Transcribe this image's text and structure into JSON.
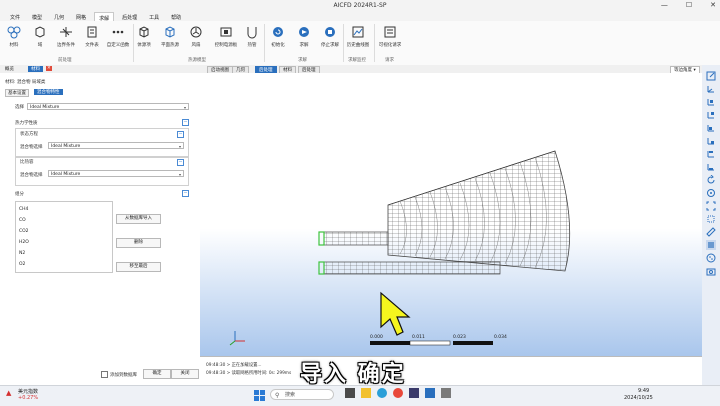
{
  "window": {
    "title": "AICFD 2024R1-SP",
    "controls": [
      "—",
      "☐",
      "✕"
    ]
  },
  "menu": [
    "文件",
    "模型",
    "几何",
    "网格",
    "求解",
    "后处理",
    "工具",
    "帮助"
  ],
  "menu_active_index": 4,
  "ribbon": {
    "buttons": [
      "材料",
      "域",
      "边界条件",
      "文件表",
      "自定义函数",
      "体源项",
      "平面热源",
      "风扇",
      "控制电源板",
      "热管",
      "初始化",
      "求解",
      "停止求解",
      "历史曲线图",
      "可视化请求"
    ],
    "groups": [
      "前处理",
      "热源模型",
      "求解",
      "求解监控",
      "请求"
    ]
  },
  "left_tabs": [
    "概览",
    "材料"
  ],
  "panel": {
    "breadcrumb": "材料: 混合物 局域类",
    "subtabs": [
      "基本设置",
      "混合物特性"
    ],
    "select_label": "选择",
    "select_value": "Ideal Mixture",
    "thermo_section": "热力学性质",
    "eos_label": "状态方程",
    "mix_select_label": "混合物选择",
    "eos_value": "Ideal Mixture",
    "cp_label": "比热容",
    "cp_value": "Ideal Mixture",
    "components_section": "组分",
    "components": [
      "CH4",
      "CO",
      "CO2",
      "H2O",
      "N2",
      "O2"
    ],
    "import_button": "从数据库导入",
    "delete_button": "删除",
    "move_last_button": "移至最后",
    "add_db_checkbox": "添加到数据库",
    "ok_button": "确定",
    "close_button": "关闭"
  },
  "viewport": {
    "tabs": [
      "启动视图",
      "几何",
      "后处理",
      "材料",
      "后处理"
    ],
    "active_tab_index": 2,
    "view_select": "等边角度",
    "scale_labels": [
      "0.000",
      "0.011",
      "0.023",
      "0.034"
    ]
  },
  "console": {
    "lines": [
      "09:48:30 > 正在加载设置...",
      "09:48:30 > 读取网格所用时间: 0s: 299ms"
    ]
  },
  "subtitle": "导入 确定",
  "taskbar": {
    "weather_title": "美元指数",
    "weather_value": "+0.27%",
    "search_placeholder": "搜索",
    "time": "9:49",
    "date": "2024/10/25"
  },
  "colors": {
    "accent": "#2a6fbd",
    "delete_tab": "#e04a3a",
    "mesh": "#555555",
    "boundary_green": "#3ec43e",
    "cursor": "#f5f51e"
  }
}
